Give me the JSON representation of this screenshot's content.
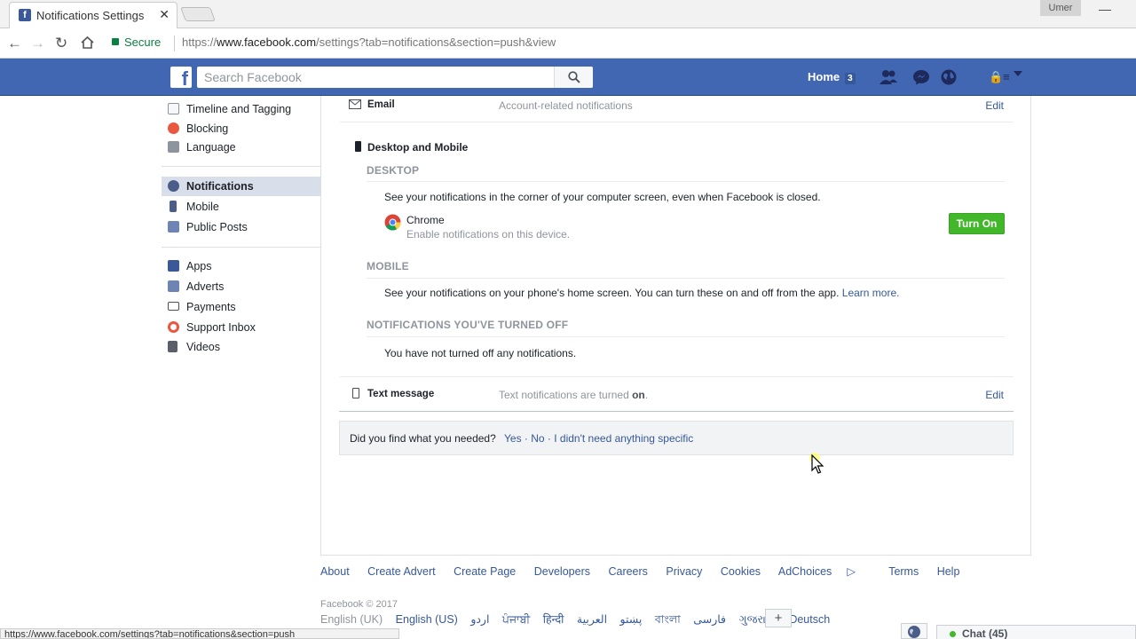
{
  "browser": {
    "tab_title": "Notifications Settings",
    "tab_close": "✕",
    "profile_name": "Umer",
    "minimize": "—",
    "secure_label": "Secure",
    "url_scheme": "https://",
    "url_host": "www.facebook.com",
    "url_path": "/settings?tab=notifications&section=push&view",
    "status_url": "https://www.facebook.com/settings?tab=notifications&section=push"
  },
  "fb_header": {
    "logo": "f",
    "search_placeholder": "Search Facebook",
    "home_label": "Home",
    "home_count": "3",
    "brand_color": "#4267b2"
  },
  "sidebar": {
    "group1": [
      {
        "label": "Timeline and Tagging",
        "icon": "timeline-icon"
      },
      {
        "label": "Blocking",
        "icon": "blocking-icon"
      },
      {
        "label": "Language",
        "icon": "language-icon"
      }
    ],
    "group2": [
      {
        "label": "Notifications",
        "icon": "globe-icon",
        "active": true
      },
      {
        "label": "Mobile",
        "icon": "mobile-icon"
      },
      {
        "label": "Public Posts",
        "icon": "rss-icon"
      }
    ],
    "group3": [
      {
        "label": "Apps",
        "icon": "apps-icon"
      },
      {
        "label": "Adverts",
        "icon": "adverts-icon"
      },
      {
        "label": "Payments",
        "icon": "payments-icon"
      },
      {
        "label": "Support Inbox",
        "icon": "support-icon"
      },
      {
        "label": "Videos",
        "icon": "videos-icon"
      }
    ]
  },
  "main": {
    "email": {
      "title": "Email",
      "desc": "Account-related notifications",
      "edit": "Edit"
    },
    "desktop_mobile": {
      "title": "Desktop and Mobile",
      "desktop_head": "DESKTOP",
      "desktop_text": "See your notifications in the corner of your computer screen, even when Facebook is closed.",
      "chrome_name": "Chrome",
      "chrome_desc": "Enable notifications on this device.",
      "turn_on": "Turn On",
      "mobile_head": "MOBILE",
      "mobile_text": "See your notifications on your phone's home screen. You can turn these on and off from the app.",
      "learn_more": "Learn more.",
      "off_head": "NOTIFICATIONS YOU'VE TURNED OFF",
      "off_text": "You have not turned off any notifications."
    },
    "text_message": {
      "title": "Text message",
      "desc_prefix": "Text notifications are turned ",
      "desc_state": "on",
      "desc_suffix": ".",
      "edit": "Edit"
    },
    "feedback": {
      "question": "Did you find what you needed?",
      "answers": "Yes · No · I didn't need anything specific"
    }
  },
  "footer": {
    "links": [
      "About",
      "Create Advert",
      "Create Page",
      "Developers",
      "Careers",
      "Privacy",
      "Cookies",
      "AdChoices",
      "Terms",
      "Help"
    ],
    "copyright": "Facebook © 2017",
    "current_lang": "English (UK)",
    "languages": [
      "English (US)",
      "اردو",
      "ਪੰਜਾਬੀ",
      "हिन्दी",
      "پښتو",
      "العربية",
      "বাংলা",
      "فارسی",
      "ગુજરાતી",
      "Deutsch"
    ],
    "plus": "+"
  },
  "chat": {
    "label": "Chat (45)"
  }
}
